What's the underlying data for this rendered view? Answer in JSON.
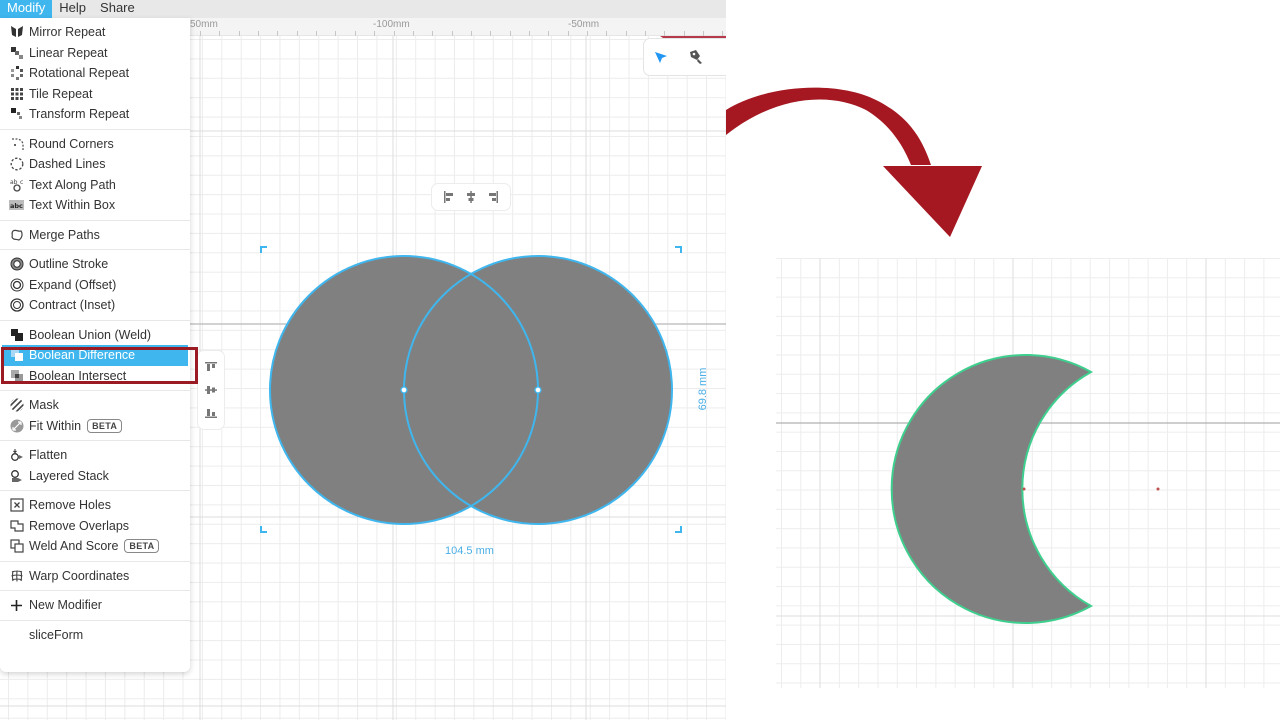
{
  "menubar": {
    "items": [
      {
        "label": "Modify",
        "active": true
      },
      {
        "label": "Help",
        "active": false
      },
      {
        "label": "Share",
        "active": false
      }
    ]
  },
  "ruler": {
    "labels": [
      "50mm",
      "-100mm",
      "-50mm"
    ]
  },
  "modify_menu": {
    "groups": [
      [
        {
          "label": "Mirror Repeat",
          "icon": "mirror-repeat-icon"
        },
        {
          "label": "Linear Repeat",
          "icon": "linear-repeat-icon"
        },
        {
          "label": "Rotational Repeat",
          "icon": "rotational-repeat-icon"
        },
        {
          "label": "Tile Repeat",
          "icon": "tile-repeat-icon"
        },
        {
          "label": "Transform Repeat",
          "icon": "transform-repeat-icon"
        }
      ],
      [
        {
          "label": "Round Corners",
          "icon": "round-corners-icon"
        },
        {
          "label": "Dashed Lines",
          "icon": "dashed-lines-icon"
        },
        {
          "label": "Text Along Path",
          "icon": "text-along-path-icon"
        },
        {
          "label": "Text Within Box",
          "icon": "text-within-box-icon"
        }
      ],
      [
        {
          "label": "Merge Paths",
          "icon": "merge-paths-icon"
        }
      ],
      [
        {
          "label": "Outline Stroke",
          "icon": "outline-stroke-icon"
        },
        {
          "label": "Expand (Offset)",
          "icon": "expand-offset-icon"
        },
        {
          "label": "Contract (Inset)",
          "icon": "contract-inset-icon"
        }
      ],
      [
        {
          "label": "Boolean Union (Weld)",
          "icon": "boolean-union-icon"
        },
        {
          "label": "Boolean Difference",
          "icon": "boolean-difference-icon",
          "selected": true
        },
        {
          "label": "Boolean Intersect",
          "icon": "boolean-intersect-icon"
        }
      ],
      [
        {
          "label": "Mask",
          "icon": "mask-icon"
        },
        {
          "label": "Fit Within",
          "icon": "fit-within-icon",
          "badge": "BETA"
        }
      ],
      [
        {
          "label": "Flatten",
          "icon": "flatten-icon"
        },
        {
          "label": "Layered Stack",
          "icon": "layered-stack-icon"
        }
      ],
      [
        {
          "label": "Remove Holes",
          "icon": "remove-holes-icon"
        },
        {
          "label": "Remove Overlaps",
          "icon": "remove-overlaps-icon"
        },
        {
          "label": "Weld And Score",
          "icon": "weld-and-score-icon",
          "badge": "BETA"
        }
      ],
      [
        {
          "label": "Warp Coordinates",
          "icon": "warp-coordinates-icon"
        }
      ],
      [
        {
          "label": "New Modifier",
          "icon": "plus-icon"
        }
      ],
      [
        {
          "label": "sliceForm",
          "icon": ""
        }
      ]
    ]
  },
  "canvas": {
    "selection": {
      "width_label": "104.5 mm",
      "height_label": "69.8 mm"
    },
    "shape_fill": "#808080",
    "selection_color": "#3fb6ee",
    "result_stroke": "#3ecf8e"
  },
  "annotation": {
    "highlight_color": "#9b1b24",
    "arrow_color": "#a51822"
  }
}
